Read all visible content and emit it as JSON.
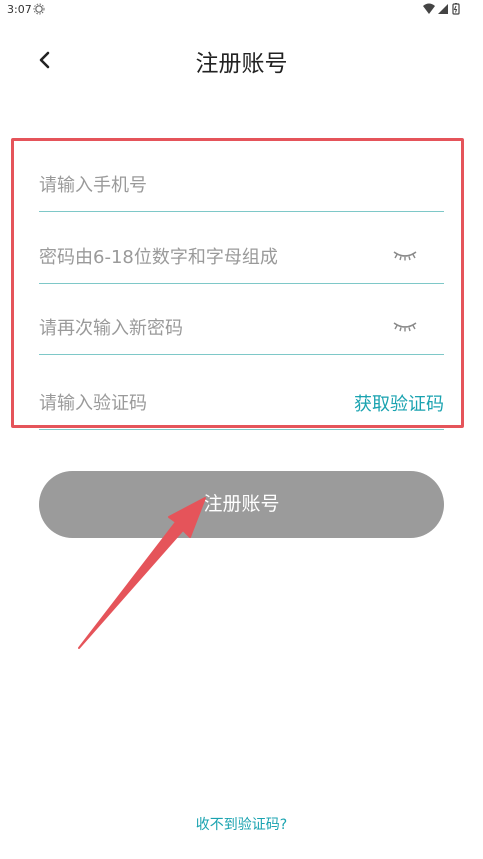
{
  "status_bar": {
    "time": "3:07"
  },
  "header": {
    "title": "注册账号"
  },
  "form": {
    "phone_placeholder": "请输入手机号",
    "password_placeholder": "密码由6-18位数字和字母组成",
    "confirm_password_placeholder": "请再次输入新密码",
    "code_placeholder": "请输入验证码",
    "get_code_label": "获取验证码"
  },
  "register_button": {
    "label": "注册账号"
  },
  "footer": {
    "no_code_link": "收不到验证码?"
  },
  "colors": {
    "accent": "#1aa3b0",
    "divider": "#7ec8c8",
    "button_disabled": "#9b9b9b",
    "annotation_red": "#e5545a"
  }
}
